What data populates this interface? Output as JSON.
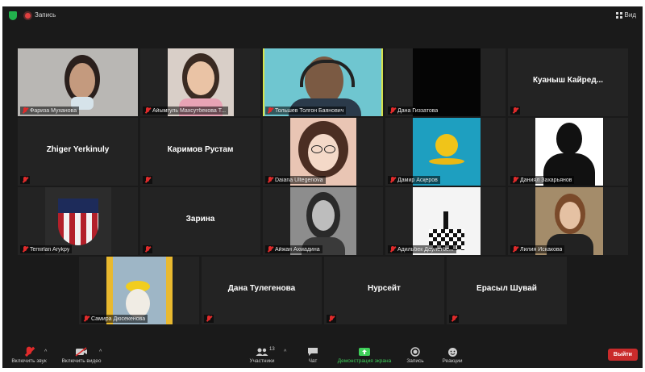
{
  "topbar": {
    "recording_label": "Запись",
    "view_label": "Вид"
  },
  "tiles": [
    {
      "name": "Фариза Муханова",
      "kind": "video"
    },
    {
      "name": "Айымгуль Махсутбекова Т...",
      "kind": "video"
    },
    {
      "name": "Тольшев Толгон Баянович",
      "kind": "video",
      "active": true
    },
    {
      "name": "Дана Гиззатова",
      "kind": "video"
    },
    {
      "center": "Куаныш Кайред..."
    },
    {
      "center": "Zhiger Yerkinuly"
    },
    {
      "center": "Каримов Рустам"
    },
    {
      "name": "Daiana Ultegenova",
      "kind": "video"
    },
    {
      "name": "Дамир Асқеров",
      "kind": "video"
    },
    {
      "name": "Даниял Захарьянов",
      "kind": "video"
    },
    {
      "name": "Temirlan Arykpy",
      "kind": "video"
    },
    {
      "center": "Зарина"
    },
    {
      "name": "Айжан Ахмадина",
      "kind": "video"
    },
    {
      "name": "Адильбек Даулетбе...",
      "kind": "video"
    },
    {
      "name": "Лилия Искакова",
      "kind": "video"
    },
    {
      "name": "Самира Дюсекенова",
      "kind": "video"
    },
    {
      "center": "Дана Тулегенова"
    },
    {
      "center": "Нурсейт"
    },
    {
      "center": "Ерасыл Шувай"
    }
  ],
  "toolbar": {
    "unmute": "Включить звук",
    "start_video": "Включить видео",
    "participants": "Участники",
    "participants_count": "13",
    "chat": "Чат",
    "share": "Демонстрация экрана",
    "record": "Запись",
    "reactions": "Реакции",
    "leave": "Выйти"
  },
  "colors": {
    "active_speaker": "#d6e14a",
    "share_green": "#3fcf5a",
    "leave_red": "#c92b2b"
  }
}
